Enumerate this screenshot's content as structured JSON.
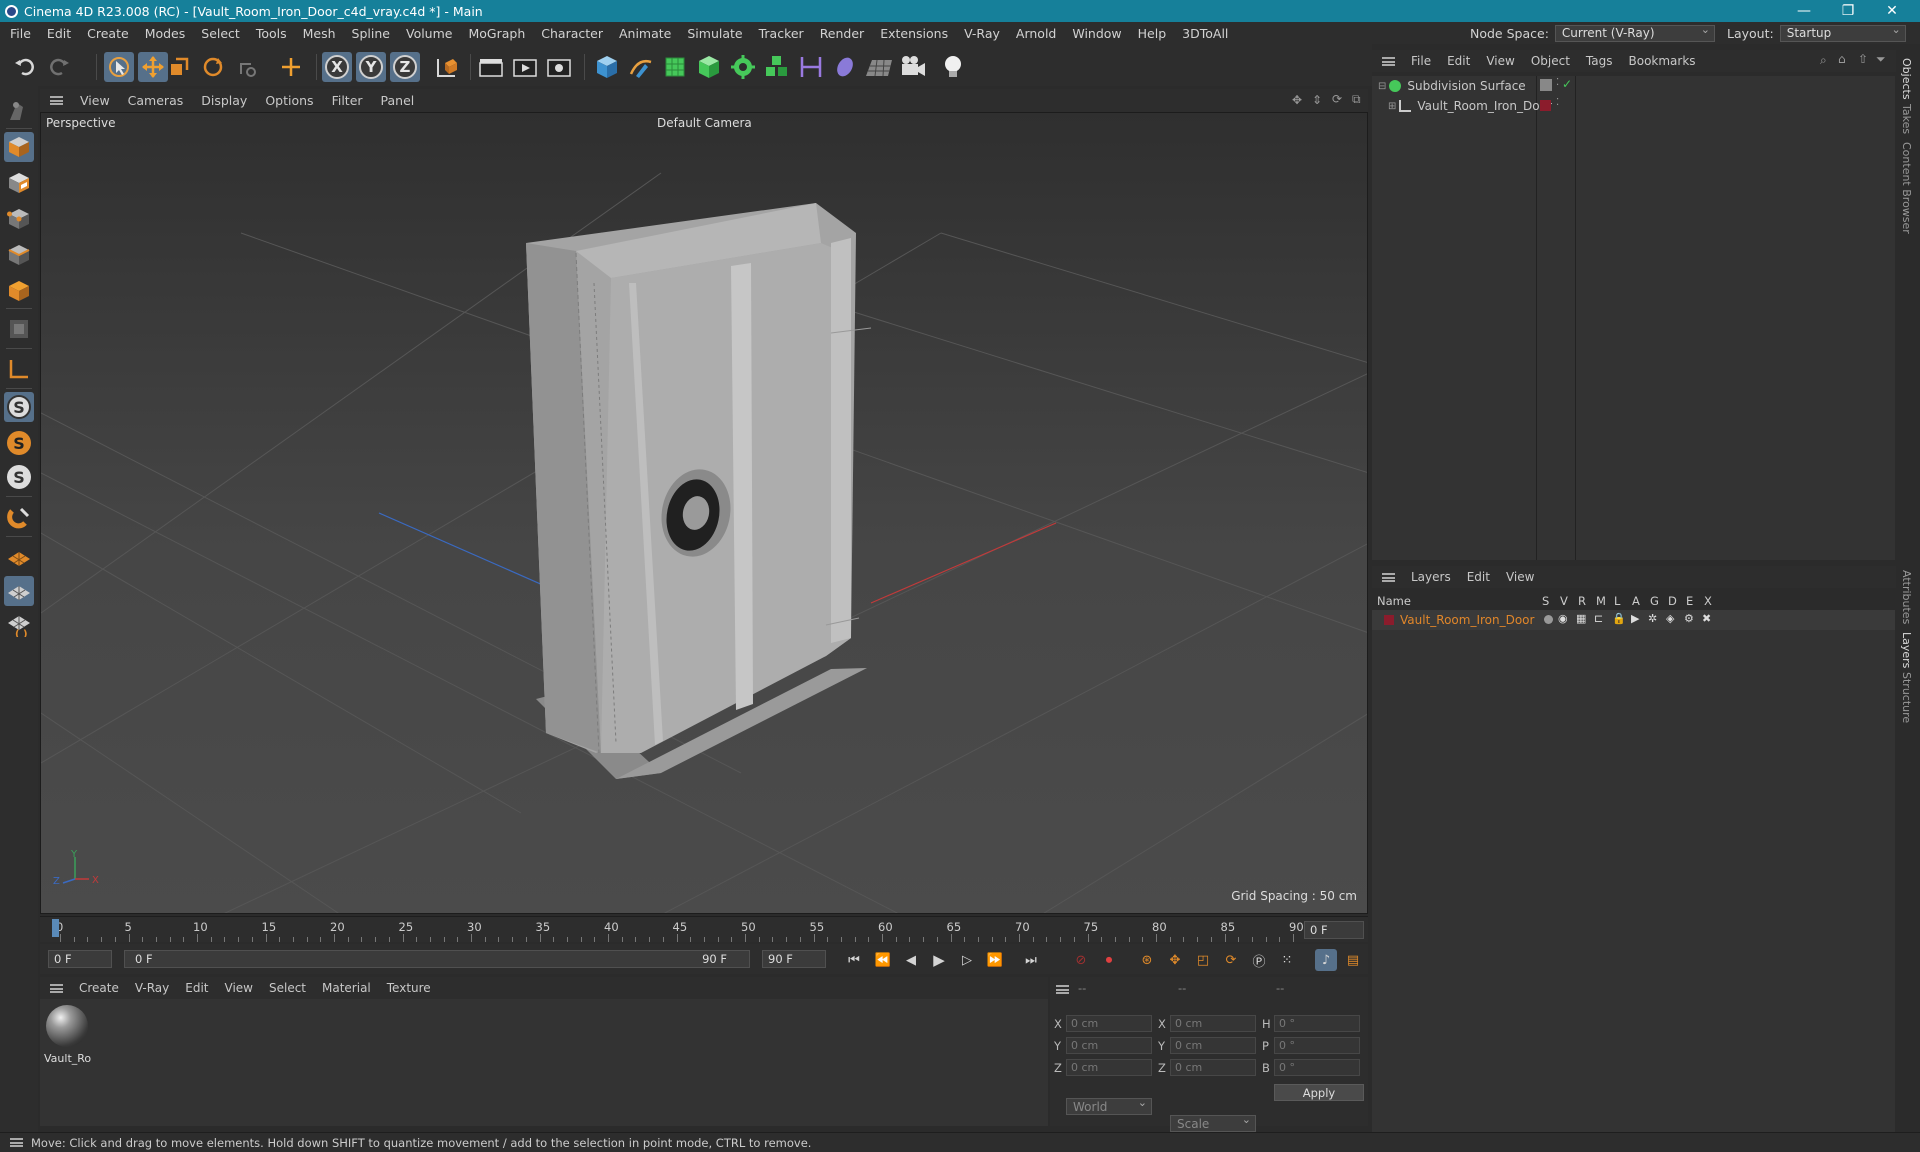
{
  "app": {
    "title": "Cinema 4D R23.008 (RC) - [Vault_Room_Iron_Door_c4d_vray.c4d *] - Main"
  },
  "menubar": {
    "items": [
      "File",
      "Edit",
      "Create",
      "Modes",
      "Select",
      "Tools",
      "Mesh",
      "Spline",
      "Volume",
      "MoGraph",
      "Character",
      "Animate",
      "Simulate",
      "Tracker",
      "Render",
      "Extensions",
      "V-Ray",
      "Arnold",
      "Window",
      "Help",
      "3DToAll"
    ],
    "node_space_label": "Node Space:",
    "node_space_value": "Current (V-Ray)",
    "layout_label": "Layout:",
    "layout_value": "Startup"
  },
  "toolbar": {
    "x_label": "X",
    "y_label": "Y",
    "z_label": "Z"
  },
  "viewport": {
    "menu": [
      "View",
      "Cameras",
      "Display",
      "Options",
      "Filter",
      "Panel"
    ],
    "view_name": "Perspective",
    "camera": "Default Camera",
    "grid_spacing": "Grid Spacing : 50 cm",
    "axis_x": "X",
    "axis_y": "Y",
    "axis_z": "Z"
  },
  "objects": {
    "menu": [
      "File",
      "Edit",
      "View",
      "Object",
      "Tags",
      "Bookmarks"
    ],
    "items": [
      {
        "name": "Subdivision Surface"
      },
      {
        "name": "Vault_Room_Iron_Door"
      }
    ]
  },
  "layers": {
    "menu": [
      "Layers",
      "Edit",
      "View"
    ],
    "columns": [
      "Name",
      "S",
      "V",
      "R",
      "M",
      "L",
      "A",
      "G",
      "D",
      "E",
      "X"
    ],
    "items": [
      {
        "name": "Vault_Room_Iron_Door",
        "color": "#8b1c2c"
      }
    ]
  },
  "side_tabs": [
    "Objects",
    "Takes",
    "Content Browser",
    "Attributes",
    "Layers",
    "Structure"
  ],
  "timeline": {
    "ticks": [
      "0",
      "5",
      "10",
      "15",
      "20",
      "25",
      "30",
      "35",
      "40",
      "45",
      "50",
      "55",
      "60",
      "65",
      "70",
      "75",
      "80",
      "85",
      "90"
    ],
    "current_frame": "0 F",
    "start_field": "0 F",
    "range_start": "0 F",
    "range_end": "90 F",
    "end_field": "90 F"
  },
  "materials": {
    "menu": [
      "Create",
      "V-Ray",
      "Edit",
      "View",
      "Select",
      "Material",
      "Texture"
    ],
    "items": [
      {
        "name": "Vault_Ro"
      }
    ]
  },
  "coords": {
    "header": [
      "--",
      "--",
      "--"
    ],
    "rows": [
      {
        "l1": "X",
        "v1": "0 cm",
        "l2": "X",
        "v2": "0 cm",
        "l3": "H",
        "v3": "0 °"
      },
      {
        "l1": "Y",
        "v1": "0 cm",
        "l2": "Y",
        "v2": "0 cm",
        "l3": "P",
        "v3": "0 °"
      },
      {
        "l1": "Z",
        "v1": "0 cm",
        "l2": "Z",
        "v2": "0 cm",
        "l3": "B",
        "v3": "0 °"
      }
    ],
    "world": "World",
    "scale": "Scale",
    "apply": "Apply"
  },
  "status": {
    "text": "Move: Click and drag to move elements. Hold down SHIFT to quantize movement / add to the selection in point mode, CTRL to remove."
  },
  "colors": {
    "title_bar": "#16809a",
    "selected_tool": "#56708a",
    "layer_name": "#e0862a",
    "axis_x": "#c23a3a",
    "axis_y": "#3aa05a",
    "axis_z": "#3a6ac2"
  }
}
